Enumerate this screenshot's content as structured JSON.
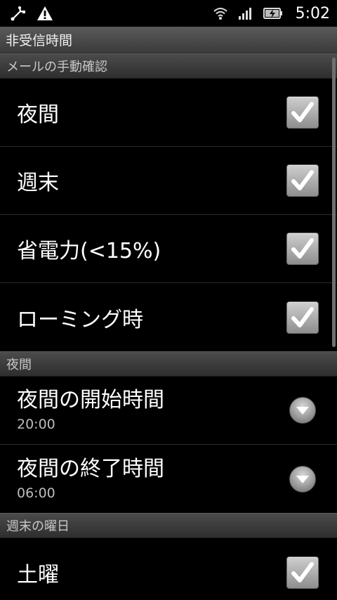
{
  "status_bar": {
    "time": "5:02",
    "icons": [
      "usb-debug-icon",
      "warning-icon",
      "wifi-icon",
      "signal-icon",
      "battery-charging-icon"
    ]
  },
  "title": "非受信時間",
  "sections": [
    {
      "header": "メールの手動確認",
      "items": [
        {
          "label": "夜間",
          "checked": true
        },
        {
          "label": "週末",
          "checked": true
        },
        {
          "label": "省電力(<15%)",
          "checked": true
        },
        {
          "label": "ローミング時",
          "checked": true
        }
      ]
    },
    {
      "header": "夜間",
      "items": [
        {
          "label": "夜間の開始時間",
          "value": "20:00"
        },
        {
          "label": "夜間の終了時間",
          "value": "06:00"
        }
      ]
    },
    {
      "header": "週末の曜日",
      "items": [
        {
          "label": "土曜",
          "checked": true
        }
      ]
    }
  ],
  "colors": {
    "background": "#000000",
    "header_bg": "#3b3b3b",
    "subtext": "#bdbdbd"
  }
}
